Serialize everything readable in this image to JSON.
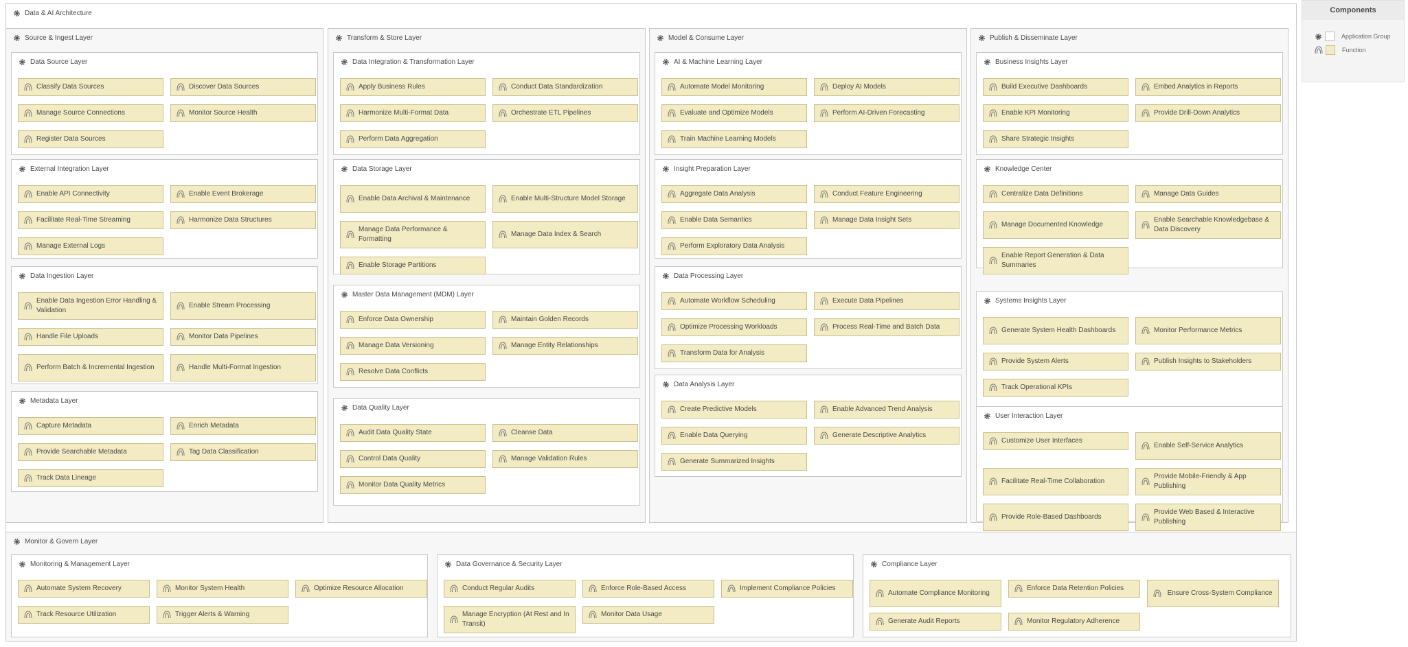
{
  "root": {
    "title": "Data & AI Architecture"
  },
  "legend": {
    "title": "Components",
    "group_label": "Application Group",
    "function_label": "Function"
  },
  "columns": [
    {
      "title": "Source & Ingest Layer",
      "groups": [
        {
          "title": "Data Source Layer",
          "items": [
            "Classify Data Sources",
            "Discover Data Sources",
            "Manage Source Connections",
            "Monitor Source Health",
            "Register Data Sources"
          ]
        },
        {
          "title": "External Integration Layer",
          "items": [
            "Enable API Connectivity",
            "Enable Event Brokerage",
            "Facilitate Real-Time Streaming",
            "Harmonize Data Structures",
            "Manage External Logs"
          ]
        },
        {
          "title": "Data Ingestion Layer",
          "items": [
            "Enable Data Ingestion Error Handling & Validation",
            "Enable Stream Processing",
            "Handle File Uploads",
            "Monitor Data Pipelines",
            "Perform Batch & Incremental Ingestion",
            "Handle Multi-Format Ingestion"
          ]
        },
        {
          "title": "Metadata Layer",
          "items": [
            "Capture Metadata",
            "Enrich Metadata",
            "Provide Searchable Metadata",
            "Tag Data Classification",
            "Track Data Lineage"
          ]
        }
      ]
    },
    {
      "title": "Transform & Store Layer",
      "groups": [
        {
          "title": "Data Integration & Transformation Layer",
          "items": [
            "Apply Business Rules",
            "Conduct Data Standardization",
            "Harmonize Multi-Format Data",
            "Orchestrate ETL Pipelines",
            "Perform Data Aggregation"
          ]
        },
        {
          "title": "Data Storage Layer",
          "items": [
            "Enable Data Archival & Maintenance",
            "Enable Multi-Structure Model Storage",
            "Manage Data Performance & Formatting",
            "Manage Data Index & Search",
            "Enable Storage Partitions"
          ]
        },
        {
          "title": "Master Data Management (MDM) Layer",
          "items": [
            "Enforce Data Ownership",
            "Maintain Golden Records",
            "Manage Data Versioning",
            "Manage Entity Relationships",
            "Resolve Data Conflicts"
          ]
        },
        {
          "title": "Data Quality Layer",
          "items": [
            "Audit Data Quality State",
            "Cleanse Data",
            "Control Data Quality",
            "Manage Validation Rules",
            "Monitor Data Quality Metrics"
          ]
        }
      ]
    },
    {
      "title": "Model & Consume Layer",
      "groups": [
        {
          "title": "AI & Machine Learning Layer",
          "items": [
            "Automate Model Monitoring",
            "Deploy AI Models",
            "Evaluate and Optimize Models",
            "Perform AI-Driven Forecasting",
            "Train Machine Learning Models"
          ]
        },
        {
          "title": "Insight Preparation Layer",
          "items": [
            "Aggregate Data Analysis",
            "Conduct Feature Engineering",
            "Enable Data Semantics",
            "Manage Data Insight Sets",
            "Perform Exploratory Data Analysis"
          ]
        },
        {
          "title": "Data Processing Layer",
          "items": [
            "Automate Workflow Scheduling",
            "Execute Data Pipelines",
            "Optimize Processing Workloads",
            "Process Real-Time and Batch Data",
            "Transform Data for Analysis"
          ]
        },
        {
          "title": "Data Analysis Layer",
          "items": [
            "Create Predictive Models",
            "Enable Advanced Trend Analysis",
            "Enable Data Querying",
            "Generate Descriptive Analytics",
            "Generate Summarized Insights"
          ]
        }
      ]
    },
    {
      "title": "Publish & Disseminate Layer",
      "groups": [
        {
          "title": "Business Insights Layer",
          "items": [
            "Build Executive Dashboards",
            "Embed Analytics in Reports",
            "Enable KPI Monitoring",
            "Provide Drill-Down Analytics",
            "Share Strategic Insights"
          ]
        },
        {
          "title": "Knowledge Center",
          "items": [
            "Centralize Data Definitions",
            "Manage Data Guides",
            "Manage Documented Knowledge",
            "Enable Searchable Knowledgebase & Data Discovery",
            "Enable Report Generation & Data Summaries"
          ]
        },
        {
          "title": "Systems Insights Layer",
          "items": [
            "Generate System Health Dashboards",
            "Monitor Performance Metrics",
            "Provide System Alerts",
            "Publish Insights to Stakeholders",
            "Track Operational KPIs"
          ]
        },
        {
          "title": "User Interaction Layer",
          "items": [
            "Customize User Interfaces",
            "Enable Self-Service Analytics",
            "Facilitate Real-Time Collaboration",
            "Provide Mobile-Friendly & App Publishing",
            "Provide Role-Based Dashboards",
            "Provide Web Based & Interactive Publishing"
          ]
        }
      ]
    }
  ],
  "monitor": {
    "title": "Monitor & Govern Layer",
    "groups": [
      {
        "title": "Monitoring & Management Layer",
        "items": [
          "Automate System Recovery",
          "Monitor System Health",
          "Optimize Resource Allocation",
          "Track Resource Utilization",
          "Trigger Alerts & Warning"
        ]
      },
      {
        "title": "Data Governance & Security Layer",
        "items": [
          "Conduct Regular Audits",
          "Enforce Role-Based Access",
          "Implement Compliance Policies",
          "Manage Encryption (At Rest and In Transit)",
          "Monitor Data Usage"
        ]
      },
      {
        "title": "Compliance Layer",
        "items": [
          "Automate Compliance Monitoring",
          "Enforce Data Retention Policies",
          "Ensure Cross-System Compliance",
          "Generate Audit Reports",
          "Monitor Regulatory Adherence"
        ]
      }
    ]
  },
  "colors": {
    "function_fill": "#f2ebc3",
    "function_border": "#c9bf8c",
    "group_border": "#c8c8c8",
    "outer_fill": "#f7f7f7"
  }
}
